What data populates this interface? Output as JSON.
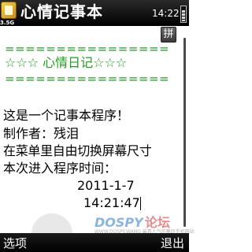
{
  "status_bar": {
    "title": "心情记事本",
    "time": "14:22",
    "network": "3.5G"
  },
  "ime_indicator": "拼",
  "note": {
    "separator_top": "================",
    "heading": "☆☆☆ 心情日记☆☆☆",
    "separator_bottom": "================",
    "lines": [
      "这是一个记事本程序！",
      "制作者：残泪",
      "在菜单里自由切换屏幕尺寸",
      "本次进入程序时间："
    ],
    "date": "2011-1-7",
    "time": "14:21:47"
  },
  "watermark": {
    "logo_dospy": "DOSPY",
    "logo_luntan": "论坛",
    "url": "WWW.DOSPY.WANG  最具人气的塞班手机网站"
  },
  "softkeys": {
    "left": "选项",
    "right": "退出"
  },
  "colors": {
    "text_green": "#1ea01e",
    "bar_background": "#000000"
  },
  "icons": {
    "app": "notepad-icon",
    "battery": "battery-icon",
    "signal": "signal-3.5g-icon"
  }
}
